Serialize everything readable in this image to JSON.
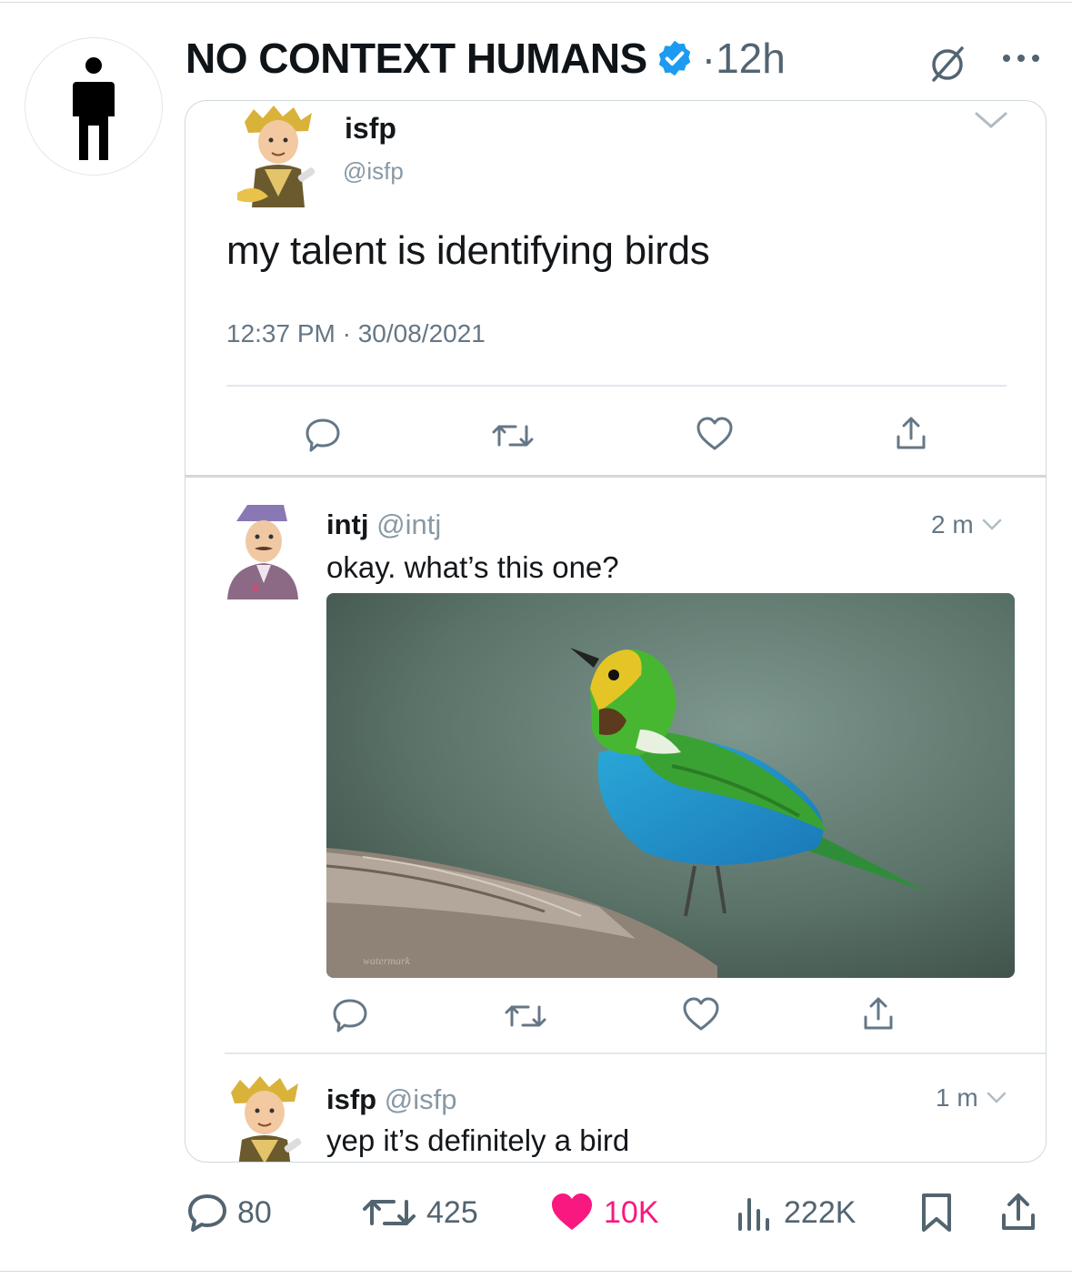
{
  "post": {
    "account_name": "NO CONTEXT HUMANS",
    "separator": "·",
    "time": "12h",
    "icons": [
      "verified-badge-icon",
      "grok-icon",
      "more-icon",
      "person-icon"
    ],
    "colors": {
      "verified": "#1d9bf0",
      "like": "#f91880",
      "muted": "#536471"
    }
  },
  "quoted": {
    "tweet1": {
      "name": "isfp",
      "handle": "@isfp",
      "text": "my talent is identifying birds",
      "timestamp": "12:37 PM · 30/08/2021"
    },
    "tweet2": {
      "name": "intj",
      "handle": "@intj",
      "time": "2 m",
      "text": "okay. what’s this one?"
    },
    "tweet3": {
      "name": "isfp",
      "handle": "@isfp",
      "time": "1 m",
      "text": "yep it’s definitely a bird"
    }
  },
  "metrics": {
    "replies": "80",
    "reposts": "425",
    "likes": "10K",
    "views": "222K"
  }
}
